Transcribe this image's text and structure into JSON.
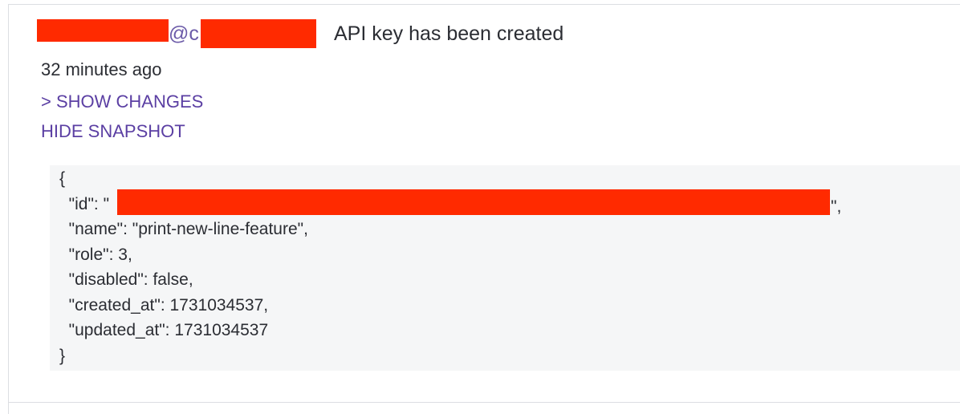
{
  "event": {
    "actor_visible": "@c",
    "title": "API key has been created",
    "time_ago": "32 minutes ago"
  },
  "actions": {
    "show_changes": "> SHOW CHANGES",
    "hide_snapshot": "HIDE SNAPSHOT"
  },
  "snapshot": {
    "open_brace": "{",
    "id_prefix": "  \"id\": \"",
    "id_suffix": "\",",
    "lines": [
      "  \"name\": \"print-new-line-feature\",",
      "  \"role\": 3,",
      "  \"disabled\": false,",
      "  \"created_at\": 1731034537,",
      "  \"updated_at\": 1731034537"
    ],
    "close_brace": "}"
  },
  "colors": {
    "redaction": "#ff2a00",
    "link": "#5b3fa3",
    "text": "#2b2d33",
    "code_background": "#f5f6f7"
  }
}
